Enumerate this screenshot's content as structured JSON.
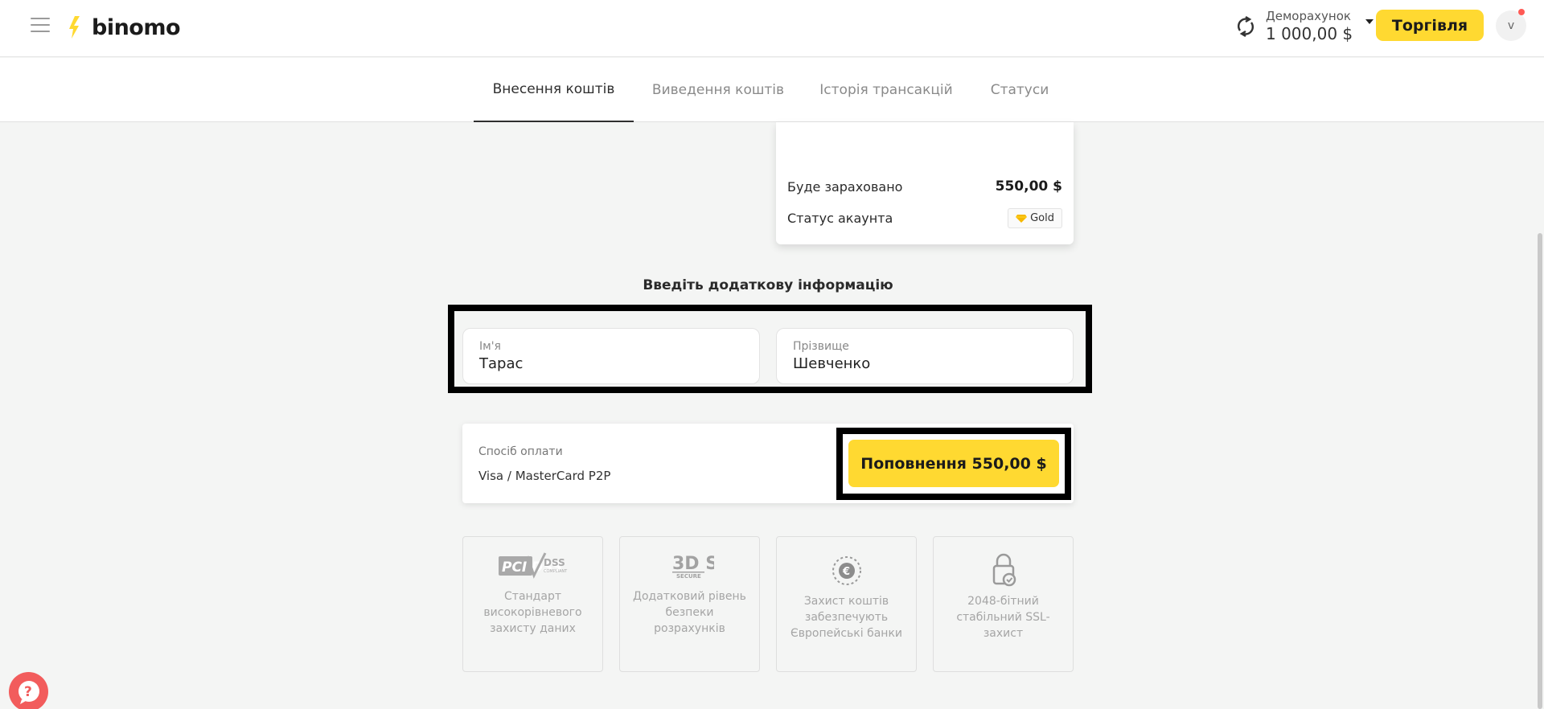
{
  "header": {
    "logo_text": "binomo",
    "account_label": "Деморахунок",
    "account_balance": "1 000,00 $",
    "trade_button": "Торгівля",
    "avatar_letter": "v"
  },
  "tabs": [
    {
      "label": "Внесення коштів",
      "active": true
    },
    {
      "label": "Виведення коштів",
      "active": false
    },
    {
      "label": "Історія трансакцій",
      "active": false
    },
    {
      "label": "Статуси",
      "active": false
    }
  ],
  "summary": {
    "credited_label": "Буде зараховано",
    "credited_value": "550,00 $",
    "status_label": "Статус акаунта",
    "status_badge": "Gold"
  },
  "form": {
    "heading": "Введіть додаткову інформацію",
    "first_name_label": "Ім'я",
    "first_name_value": "Тарас",
    "last_name_label": "Прізвище",
    "last_name_value": "Шевченко"
  },
  "payment": {
    "method_label": "Спосіб оплати",
    "method_value": "Visa / MasterCard P2P",
    "submit_button": "Поповнення 550,00 $"
  },
  "security_tiles": [
    {
      "logo_text": "PCI DSS",
      "text": "Стандарт високорівневого захисту даних"
    },
    {
      "logo_text": "3D SECURE",
      "text": "Додатковий рівень безпеки розрахунків"
    },
    {
      "icon": "euro-shield-icon",
      "text": "Захист коштів забезпечують Європейські банки"
    },
    {
      "icon": "ssl-lock-icon",
      "text": "2048-бітний стабільний SSL-захист"
    }
  ],
  "colors": {
    "accent_yellow": "#ffd931",
    "help_red": "#f25c5c"
  }
}
